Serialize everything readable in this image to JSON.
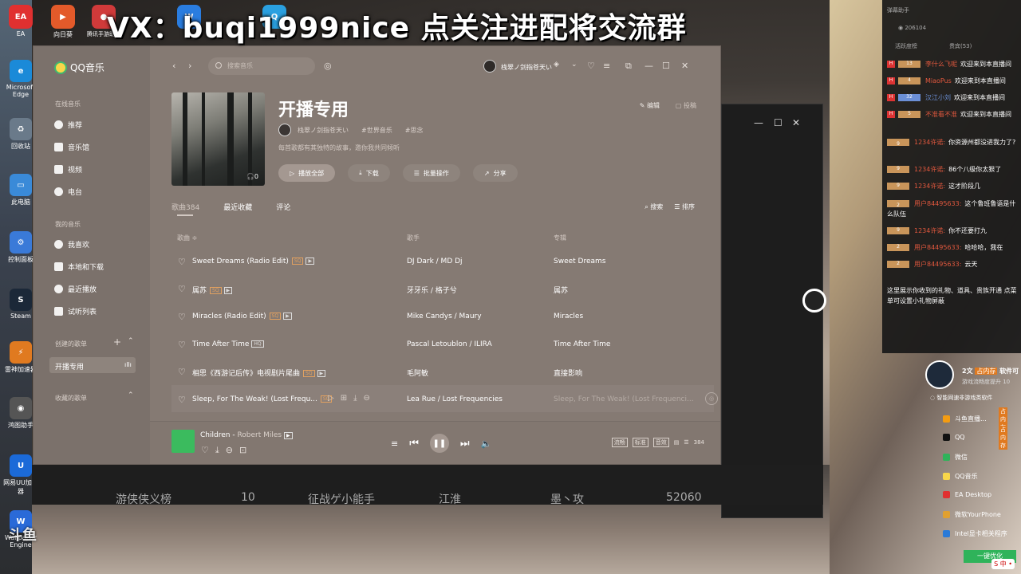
{
  "overlay": {
    "banner": "VX：buqi1999nice  点关注进配将交流群"
  },
  "desktop": {
    "top_icons": [
      {
        "label": "EA",
        "color": "#e03030"
      },
      {
        "label": "向日葵",
        "color": "#e35a2a"
      },
      {
        "label": "腾讯手游助手",
        "color": "#d03a3a"
      },
      {
        "label": "英雄联盟WeGame",
        "color": "#2a7de0"
      },
      {
        "label": "腾讯QQ",
        "color": "#2aa0e0"
      }
    ],
    "left_icons": [
      {
        "label": "Microsoft Edge",
        "color": "#1b8ad8"
      },
      {
        "label": "回收站",
        "color": "#6a7a8a"
      },
      {
        "label": "此电脑",
        "color": "#3a8ad8"
      },
      {
        "label": "控制面板",
        "color": "#3a7ad8"
      },
      {
        "label": "Steam",
        "color": "#1b2838"
      },
      {
        "label": "雷神加速器",
        "color": "#e07a20"
      },
      {
        "label": "鸿图助手",
        "color": "#555"
      },
      {
        "label": "网易UU加速器",
        "color": "#1b6ad8"
      },
      {
        "label": "Wallpaper Engine",
        "color": "#2a6ad8"
      }
    ]
  },
  "qq": {
    "app_name": "QQ音乐",
    "search_placeholder": "搜索音乐",
    "user_name": "栈翠ノ剑指苍天い",
    "sidebar": {
      "section_online": "在线音乐",
      "online_items": [
        "推荐",
        "音乐馆",
        "视频",
        "电台"
      ],
      "section_mine": "我的音乐",
      "mine_items": [
        "我喜欢",
        "本地和下载",
        "最近播放",
        "试听列表"
      ],
      "section_created": "创建的歌单",
      "created_items": [
        "开播专用"
      ],
      "section_collected": "收藏的歌单"
    },
    "playlist": {
      "title": "开播专用",
      "author": "栈翠ノ剑指苍天い",
      "tags": [
        "#世界音乐",
        "#思念"
      ],
      "description": "每首歌都有其独特的故事，邀你我共同倾听",
      "cover_count": "0",
      "edit": "编辑",
      "report": "投稿",
      "actions": [
        "播放全部",
        "下载",
        "批量操作",
        "分享"
      ]
    },
    "tabs": [
      "歌曲384",
      "最近收藏",
      "评论"
    ],
    "tools": [
      "搜索",
      "排序"
    ],
    "columns": {
      "song": "歌曲 ≑",
      "artist": "歌手",
      "album": "专辑"
    },
    "songs": [
      {
        "title": "Sweet Dreams (Radio Edit)",
        "artist": "DJ Dark / MD Dj",
        "album": "Sweet Dreams"
      },
      {
        "title": "属苏",
        "artist": "牙牙乐 / 格子兮",
        "album": "属苏"
      },
      {
        "title": "Miracles (Radio Edit)",
        "artist": "Mike Candys / Maury",
        "album": "Miracles"
      },
      {
        "title": "Time After Time",
        "artist": "Pascal Letoublon / ILIRA",
        "album": "Time After Time"
      },
      {
        "title": "相思《西游记后传》电视剧片尾曲",
        "artist": "毛阿敏",
        "album": "直接影响"
      },
      {
        "title": "Sleep, For The Weak! (Lost Frequ...",
        "artist": "Lea Rue / Lost Frequencies",
        "album": "Sleep, For The Weak! (Lost Frequenci..."
      }
    ],
    "player": {
      "title": "Children",
      "artist": "Robert Miles",
      "chips": [
        "流畅",
        "标准",
        "音效"
      ],
      "count": "384"
    }
  },
  "bg_window": {
    "rank": "10",
    "name": "征战ゲ小能手",
    "server": "江淮",
    "guild": "墨丶攻",
    "score": "52060",
    "left_label": "游侠侠义榜"
  },
  "chat": {
    "header": "弹幕助手",
    "viewers": "206104",
    "tabs": [
      "活跃度榜",
      "贵宾(53)"
    ],
    "enter_lines": [
      {
        "level": "13",
        "user": "李什么飞呢",
        "text": "欢迎来到本直播间"
      },
      {
        "level": "4",
        "user": "MiaoPus",
        "text": "欢迎来到本直播间"
      },
      {
        "level": "32",
        "user": "汉江小刘",
        "text": "欢迎来到本直播间"
      },
      {
        "level": "5",
        "user": "不准看不准",
        "text": "欢迎来到本直播间"
      }
    ],
    "messages": [
      {
        "level": "9",
        "user": "1234许诺:",
        "text": "你资源州都没进我力了?"
      },
      {
        "level": "9",
        "user": "1234许诺:",
        "text": "86个八级你太狠了"
      },
      {
        "level": "9",
        "user": "1234许诺:",
        "text": "这才阶段几"
      },
      {
        "level": "2",
        "user": "用户84495633:",
        "text": "这个鲁班鲁语是什么队伍"
      },
      {
        "level": "9",
        "user": "1234许诺:",
        "text": "你不还要打九"
      },
      {
        "level": "2",
        "user": "用户84495633:",
        "text": "哈哈哈，我在"
      },
      {
        "level": "2",
        "user": "用户84495633:",
        "text": "云天"
      }
    ],
    "footer": "这里展示你收到的礼物、道具、贵族开通 点菜单可设置小礼物屏蔽"
  },
  "software": {
    "title": "2文",
    "title_tag": "占内存",
    "title_suffix": "软件可",
    "subtitle": "游戏流畅度提升 10",
    "tip": "智能网速非游戏类软件",
    "items": [
      {
        "name": "斗鱼直播...",
        "color": "#f39c12",
        "hot": "占内存"
      },
      {
        "name": "QQ",
        "color": "#111",
        "hot": "占内存"
      },
      {
        "name": "微信",
        "color": "#2fb35a",
        "hot": ""
      },
      {
        "name": "QQ音乐",
        "color": "#f8d64a",
        "hot": ""
      },
      {
        "name": "EA Desktop",
        "color": "#e03030",
        "hot": ""
      },
      {
        "name": "微软YourPhone",
        "color": "#e0a030",
        "hot": ""
      },
      {
        "name": "Intel显卡相关程序",
        "color": "#2a7ad8",
        "hot": ""
      }
    ],
    "button": "一键优化"
  },
  "watermark": "斗鱼",
  "ime": "S 中 •"
}
